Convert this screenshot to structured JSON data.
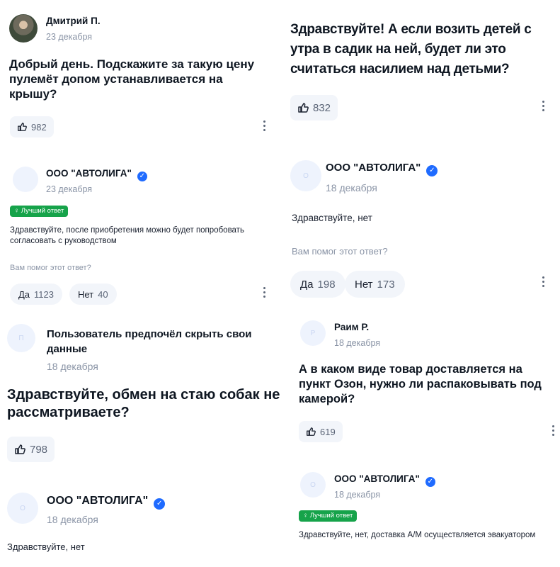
{
  "left": {
    "q1": {
      "author": "Дмитрий П.",
      "date": "23 декабря",
      "question": "Добрый день. Подскажите за такую цену пулемёт допом устанавливается на крышу?",
      "likes": "982"
    },
    "a1": {
      "author": "ООО \"АВТОЛИГА\"",
      "date": "23 декабря",
      "best_badge": "Лучший ответ",
      "text": "Здравствуйте, после приобретения можно будет попробовать согласовать с руководством",
      "helped_prompt": "Вам помог этот ответ?",
      "yes_label": "Да",
      "yes_count": "1123",
      "no_label": "Нет",
      "no_count": "40"
    },
    "q2": {
      "avatar_letter": "П",
      "author": "Пользователь предпочёл скрыть свои данные",
      "date": "18 декабря",
      "question": "Здравствуйте, обмен на стаю собак не рассматриваете?",
      "likes": "798"
    },
    "a2": {
      "avatar_letter": "О",
      "author": "ООО \"АВТОЛИГА\"",
      "date": "18 декабря",
      "text": "Здравствуйте, нет"
    }
  },
  "right": {
    "q1": {
      "question": "Здравствуйте! А если возить детей с утра в садик на ней, будет ли это считаться насилием над детьми?",
      "likes": "832"
    },
    "a1": {
      "avatar_letter": "О",
      "author": "ООО \"АВТОЛИГА\"",
      "date": "18 декабря",
      "text": "Здравствуйте, нет",
      "helped_prompt": "Вам помог этот ответ?",
      "yes_label": "Да",
      "yes_count": "198",
      "no_label": "Нет",
      "no_count": "173"
    },
    "q2": {
      "avatar_letter": "Р",
      "author": "Раим Р.",
      "date": "18 декабря",
      "question": "А в каком виде товар доставляется на пункт Озон, нужно ли распаковывать под камерой?",
      "likes": "619"
    },
    "a2": {
      "avatar_letter": "О",
      "author": "ООО \"АВТОЛИГА\"",
      "date": "18 декабря",
      "best_badge": "Лучший ответ",
      "text": "Здравствуйте, нет, доставка А/М осуществляется эвакуатором"
    }
  },
  "icons": {
    "like": "thumbs-up-icon",
    "more": "kebab-menu-icon",
    "verified": "verified-check-icon",
    "best": "award-icon"
  },
  "colors": {
    "verified": "#1f6bff",
    "best_badge": "#16a34a",
    "pill_bg": "#f2f5fa",
    "muted_text": "#8a94a6"
  }
}
